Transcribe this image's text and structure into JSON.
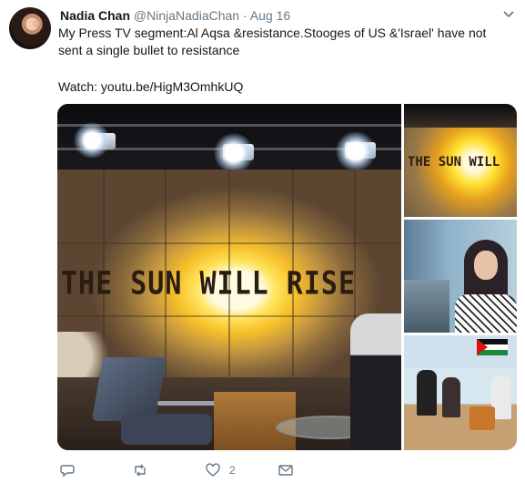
{
  "tweet": {
    "display_name": "Nadia Chan",
    "handle": "@NinjaNadiaChan",
    "separator": "·",
    "date": "Aug 16",
    "text_line1": "My Press TV segment:Al Aqsa &resistance.Stooges of US &'Israel' have not",
    "text_line2": "sent a single bullet to resistance",
    "watch_text": "Watch: youtu.be/HigM3OmhkUQ"
  },
  "media": {
    "main_caption": "THE SUN WILL RISE",
    "thumb1_caption": "THE SUN WILL"
  },
  "actions": {
    "reply_count": "",
    "retweet_count": "",
    "like_count": "2",
    "message_count": ""
  },
  "icons": {
    "reply": "reply-icon",
    "retweet": "retweet-icon",
    "like": "heart-icon",
    "message": "envelope-icon",
    "caret": "chevron-down-icon"
  },
  "colors": {
    "text_primary": "#14171a",
    "text_secondary": "#657786",
    "icon_gray": "#657786"
  }
}
